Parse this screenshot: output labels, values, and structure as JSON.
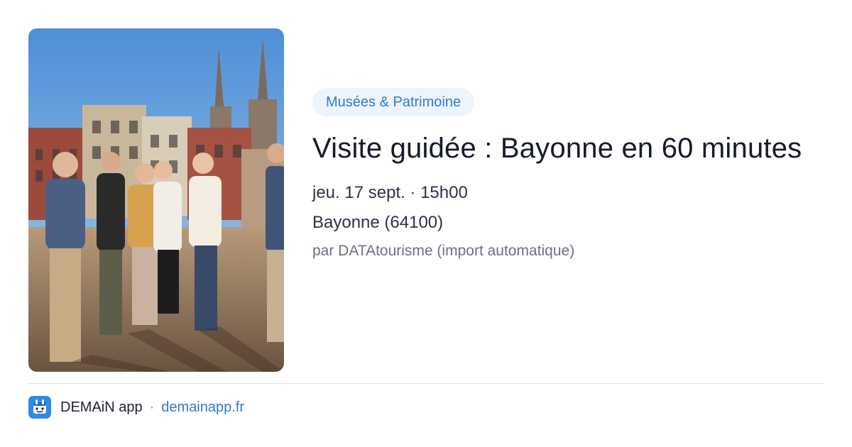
{
  "event": {
    "image_alt": "Groupe de visiteurs avec un guide devant la cathédrale de Bayonne",
    "category": "Musées & Patrimoine",
    "title": "Visite guidée : Bayonne en 60 minutes",
    "date": "jeu. 17 sept. · 15h00",
    "location": "Bayonne (64100)",
    "source": "par DATAtourisme (import automatique)"
  },
  "footer": {
    "app_icon": "demain-app-logo-icon",
    "app_name": "DEMAiN app",
    "separator": "·",
    "link": "demainapp.fr"
  },
  "colors": {
    "accent": "#2f7ad1",
    "badge_bg": "#eef4fd",
    "title": "#141b2b",
    "muted": "#6a7281"
  }
}
